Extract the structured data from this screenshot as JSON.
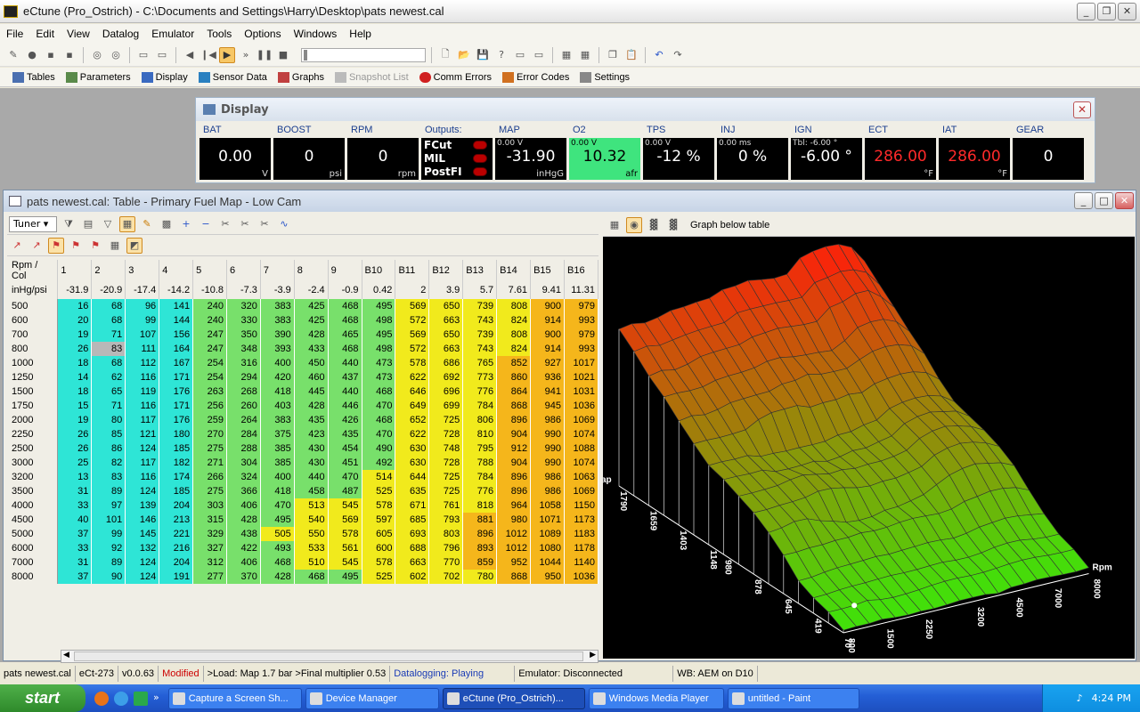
{
  "app": {
    "title": "eCtune (Pro_Ostrich) - C:\\Documents and Settings\\Harry\\Desktop\\pats newest.cal"
  },
  "menu": [
    "File",
    "Edit",
    "View",
    "Datalog",
    "Emulator",
    "Tools",
    "Options",
    "Windows",
    "Help"
  ],
  "toolbar2": [
    {
      "label": "Tables",
      "icon": "table-icon",
      "enabled": true
    },
    {
      "label": "Parameters",
      "icon": "parameters-icon",
      "enabled": true
    },
    {
      "label": "Display",
      "icon": "display-icon",
      "enabled": true
    },
    {
      "label": "Sensor Data",
      "icon": "sensor-icon",
      "enabled": true
    },
    {
      "label": "Graphs",
      "icon": "graph-icon",
      "enabled": true
    },
    {
      "label": "Snapshot List",
      "icon": "snapshot-icon",
      "enabled": false
    },
    {
      "label": "Comm Errors",
      "icon": "error-icon",
      "enabled": true
    },
    {
      "label": "Error Codes",
      "icon": "error-codes-icon",
      "enabled": true
    },
    {
      "label": "Settings",
      "icon": "settings-icon",
      "enabled": true
    }
  ],
  "display": {
    "title": "Display",
    "gauges": [
      {
        "label": "BAT",
        "value": "0.00",
        "unit": "V",
        "sub": ""
      },
      {
        "label": "BOOST",
        "value": "0",
        "unit": "psi",
        "sub": ""
      },
      {
        "label": "RPM",
        "value": "0",
        "unit": "rpm",
        "sub": ""
      },
      {
        "label": "Outputs:",
        "value": "",
        "unit": "",
        "sub": "",
        "outputs": [
          "FCut",
          "MIL",
          "PostFI"
        ]
      },
      {
        "label": "MAP",
        "value": "-31.90",
        "unit": "inHgG",
        "sub": "0.00 V"
      },
      {
        "label": "O2",
        "value": "10.32",
        "unit": "afr",
        "sub": "0.00 V"
      },
      {
        "label": "TPS",
        "value": "-12 %",
        "unit": "",
        "sub": "0.00 V"
      },
      {
        "label": "INJ",
        "value": "0 %",
        "unit": "",
        "sub": "0.00 ms"
      },
      {
        "label": "IGN",
        "value": "-6.00 °",
        "unit": "",
        "sub": "Tbl: -6.00 °"
      },
      {
        "label": "ECT",
        "value": "286.00",
        "unit": "°F",
        "sub": ""
      },
      {
        "label": "IAT",
        "value": "286.00",
        "unit": "°F",
        "sub": ""
      },
      {
        "label": "GEAR",
        "value": "0",
        "unit": "",
        "sub": ""
      }
    ]
  },
  "tablewin": {
    "title": "pats newest.cal: Table - Primary Fuel Map - Low Cam",
    "tuner_label": "Tuner",
    "graph_below_label": "Graph below table",
    "row_col_label": "Rpm / Col",
    "load_label": "inHg/psi",
    "col_headers": [
      "1",
      "2",
      "3",
      "4",
      "5",
      "6",
      "7",
      "8",
      "9",
      "B10",
      "B11",
      "B12",
      "B13",
      "B14",
      "B15",
      "B16"
    ],
    "load_values": [
      "-31.9",
      "-20.9",
      "-17.4",
      "-14.2",
      "-10.8",
      "-7.3",
      "-3.9",
      "-2.4",
      "-0.9",
      "0.42",
      "2",
      "3.9",
      "5.7",
      "7.61",
      "9.41",
      "11.31"
    ],
    "rows": [
      {
        "rpm": "500",
        "v": [
          16,
          68,
          96,
          141,
          240,
          320,
          383,
          425,
          468,
          495,
          569,
          650,
          739,
          808,
          900,
          979
        ]
      },
      {
        "rpm": "600",
        "v": [
          20,
          68,
          99,
          144,
          240,
          330,
          383,
          425,
          468,
          498,
          572,
          663,
          743,
          824,
          914,
          993
        ]
      },
      {
        "rpm": "700",
        "v": [
          19,
          71,
          107,
          156,
          247,
          350,
          390,
          428,
          465,
          495,
          569,
          650,
          739,
          808,
          900,
          979
        ]
      },
      {
        "rpm": "800",
        "v": [
          26,
          83,
          111,
          164,
          247,
          348,
          393,
          433,
          468,
          498,
          572,
          663,
          743,
          824,
          914,
          993
        ]
      },
      {
        "rpm": "1000",
        "v": [
          18,
          68,
          112,
          167,
          254,
          316,
          400,
          450,
          440,
          473,
          578,
          686,
          765,
          852,
          927,
          1017
        ]
      },
      {
        "rpm": "1250",
        "v": [
          14,
          62,
          116,
          171,
          254,
          294,
          420,
          460,
          437,
          473,
          622,
          692,
          773,
          860,
          936,
          1021
        ]
      },
      {
        "rpm": "1500",
        "v": [
          18,
          65,
          119,
          176,
          263,
          268,
          418,
          445,
          440,
          468,
          646,
          696,
          776,
          864,
          941,
          1031
        ]
      },
      {
        "rpm": "1750",
        "v": [
          15,
          71,
          116,
          171,
          256,
          260,
          403,
          428,
          446,
          470,
          649,
          699,
          784,
          868,
          945,
          1036
        ]
      },
      {
        "rpm": "2000",
        "v": [
          19,
          80,
          117,
          176,
          259,
          264,
          383,
          435,
          426,
          468,
          652,
          725,
          806,
          896,
          986,
          1069
        ]
      },
      {
        "rpm": "2250",
        "v": [
          26,
          85,
          121,
          180,
          270,
          284,
          375,
          423,
          435,
          470,
          622,
          728,
          810,
          904,
          990,
          1074
        ]
      },
      {
        "rpm": "2500",
        "v": [
          26,
          86,
          124,
          185,
          275,
          288,
          385,
          430,
          454,
          490,
          630,
          748,
          795,
          912,
          990,
          1088
        ]
      },
      {
        "rpm": "3000",
        "v": [
          25,
          82,
          117,
          182,
          271,
          304,
          385,
          430,
          451,
          492,
          630,
          728,
          788,
          904,
          990,
          1074
        ]
      },
      {
        "rpm": "3200",
        "v": [
          13,
          83,
          116,
          174,
          266,
          324,
          400,
          440,
          470,
          514,
          644,
          725,
          784,
          896,
          986,
          1063
        ]
      },
      {
        "rpm": "3500",
        "v": [
          31,
          89,
          124,
          185,
          275,
          366,
          418,
          458,
          487,
          525,
          635,
          725,
          776,
          896,
          986,
          1069
        ]
      },
      {
        "rpm": "4000",
        "v": [
          33,
          97,
          139,
          204,
          303,
          406,
          470,
          513,
          545,
          578,
          671,
          761,
          818,
          964,
          1058,
          1150
        ]
      },
      {
        "rpm": "4500",
        "v": [
          40,
          101,
          146,
          213,
          315,
          428,
          495,
          540,
          569,
          597,
          685,
          793,
          881,
          980,
          1071,
          1173
        ]
      },
      {
        "rpm": "5000",
        "v": [
          37,
          99,
          145,
          221,
          329,
          438,
          505,
          550,
          578,
          605,
          693,
          803,
          896,
          1012,
          1089,
          1183
        ]
      },
      {
        "rpm": "6000",
        "v": [
          33,
          92,
          132,
          216,
          327,
          422,
          493,
          533,
          561,
          600,
          688,
          796,
          893,
          1012,
          1080,
          1178
        ]
      },
      {
        "rpm": "7000",
        "v": [
          31,
          89,
          124,
          204,
          312,
          406,
          468,
          510,
          545,
          578,
          663,
          770,
          859,
          952,
          1044,
          1140
        ]
      },
      {
        "rpm": "8000",
        "v": [
          37,
          90,
          124,
          191,
          277,
          370,
          428,
          468,
          495,
          525,
          602,
          702,
          780,
          868,
          950,
          1036
        ]
      }
    ],
    "selected_cell": {
      "row": 3,
      "col": 1
    },
    "graph_axis": {
      "map_label": "ap",
      "rpm_label": "Rpm",
      "map_ticks": [
        "1790",
        "1659",
        "1403",
        "1148",
        "980",
        "878",
        "645",
        "419",
        "70"
      ],
      "rpm_ticks": [
        "800",
        "1500",
        "2250",
        "3200",
        "4500",
        "7000",
        "8000"
      ]
    }
  },
  "status": {
    "file": "pats newest.cal",
    "ecu": "eCt-273",
    "version": "v0.0.63",
    "modified": "Modified",
    "load": ">Load: Map 1.7 bar >Final multiplier 0.53",
    "datalog": "Datalogging: Playing",
    "emulator": "Emulator: Disconnected",
    "wb": "WB: AEM on D10"
  },
  "taskbar": {
    "start": "start",
    "tasks": [
      "Capture a Screen Sh...",
      "Device Manager",
      "eCtune (Pro_Ostrich)...",
      "Windows Media Player",
      "untitled - Paint"
    ],
    "active_task": 2,
    "time": "4:24 PM"
  },
  "colors": {
    "cyan": "#2EE5D6",
    "green": "#78E06B",
    "yellow": "#F1EA1C",
    "orange": "#F5B61B",
    "o2_bg": "#3FE47E"
  }
}
